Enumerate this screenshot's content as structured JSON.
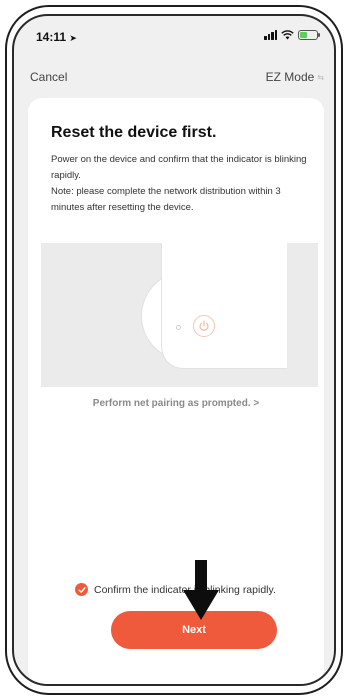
{
  "status_bar": {
    "time": "14:11",
    "location_arrow": "location-arrow-icon",
    "signal": "cellular-signal-icon",
    "wifi": "wifi-icon",
    "battery": "battery-icon"
  },
  "nav": {
    "cancel_label": "Cancel",
    "mode_label": "EZ Mode",
    "mode_icon": "swap-icon"
  },
  "card": {
    "title": "Reset the device first.",
    "description_1": "Power on the device and confirm that the indicator is blinking rapidly.",
    "description_2": "Note: please complete the network distribution within 3 minutes after resetting the device.",
    "help_link": "Perform net pairing as prompted. >"
  },
  "confirm": {
    "label": "Confirm the indicator is blinking rapidly.",
    "checked": true
  },
  "actions": {
    "next_label": "Next"
  },
  "colors": {
    "accent": "#f05a3c",
    "card_bg": "#ffffff",
    "screen_bg": "#f0f0f0",
    "illustration_bg": "#ebebeb"
  }
}
